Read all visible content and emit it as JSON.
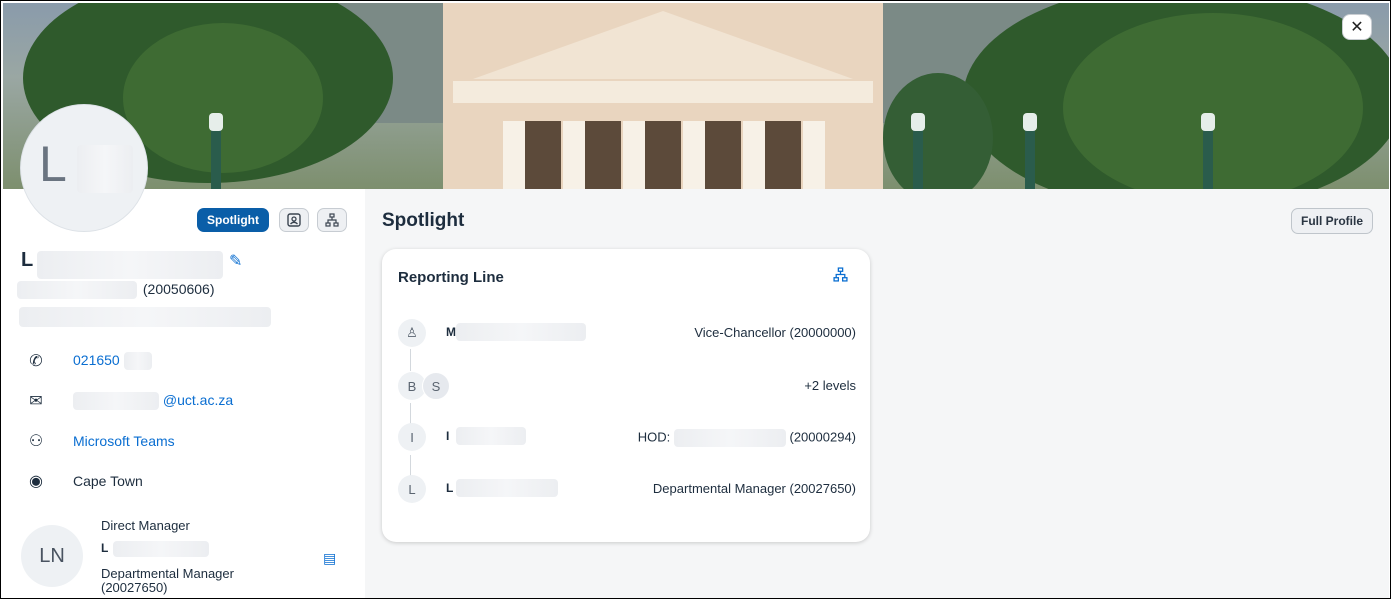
{
  "window": {
    "close_symbol": "✕"
  },
  "profile": {
    "avatar_initial": "L",
    "name_initial": "L",
    "employee_id": "(20050606)",
    "phone": "021650",
    "email": "@uct.ac.za",
    "teams": "Microsoft Teams",
    "location": "Cape Town"
  },
  "toolbar": {
    "spotlight_label": "Spotlight",
    "contact_icon": "contact-card-icon",
    "org_icon": "org-chart-icon"
  },
  "manager": {
    "title": "Direct Manager",
    "initials": "LN",
    "name_initial": "L",
    "role": "Departmental Manager (20027650)"
  },
  "main": {
    "title": "Spotlight",
    "full_profile_label": "Full Profile"
  },
  "reporting_line": {
    "title": "Reporting Line",
    "rows": [
      {
        "avatar": "♙",
        "name_initial": "M",
        "role": "Vice-Chancellor (20000000)"
      },
      {
        "avatar": "B",
        "avatar2": "S",
        "name_initial": "",
        "role": "+2 levels"
      },
      {
        "avatar": "I",
        "name_initial": "I",
        "role_prefix": "HOD:",
        "role": "(20000294)"
      },
      {
        "avatar": "L",
        "name_initial": "L",
        "role": "Departmental Manager (20027650)"
      }
    ]
  },
  "colors": {
    "accent": "#0a6ed1",
    "spotlight_bg": "#0a5ea8"
  }
}
